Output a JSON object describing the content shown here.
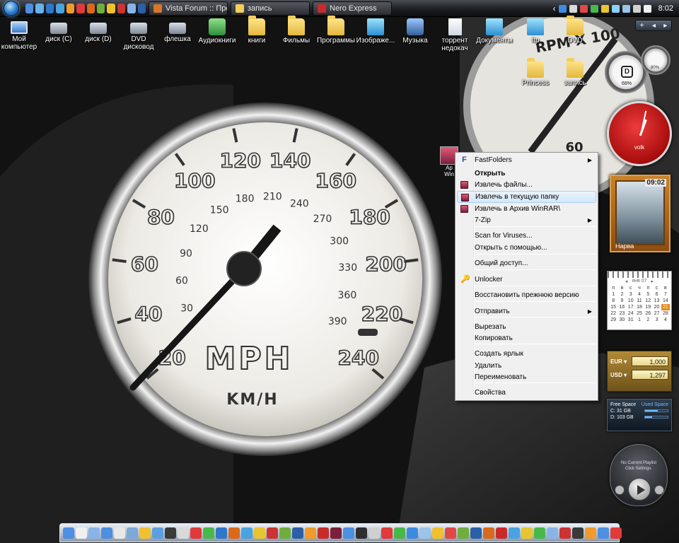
{
  "taskbar": {
    "tasks": [
      {
        "label": "Vista Forum :: Прос...",
        "color": "#d9762a"
      },
      {
        "label": "запись",
        "color": "#f2cf5d"
      },
      {
        "label": "Nero Express",
        "color": "#c92b2b"
      }
    ],
    "quick_launch_colors": [
      "#4d8fe0",
      "#69b3e8",
      "#2f77c8",
      "#4aa3df",
      "#f09b2c",
      "#e03a3a",
      "#d96a1b",
      "#6fae3c",
      "#f0c02f",
      "#cc3333",
      "#8ab4e8",
      "#2b5fa8"
    ],
    "tray_icon_colors": [
      "#3d8be0",
      "#d9d9d9",
      "#e04848",
      "#48b84a",
      "#e8c530",
      "#8bd0ff",
      "#9ac4ea",
      "#d0d0d0",
      "#f0f0f0"
    ],
    "clock": "8:02",
    "chevron": "‹"
  },
  "desktop_icons": [
    {
      "label": "Мой компьютер",
      "icon": "pc"
    },
    {
      "label": "диск (C)",
      "icon": "drive"
    },
    {
      "label": "диск (D)",
      "icon": "drive"
    },
    {
      "label": "DVD дисковод",
      "icon": "drive"
    },
    {
      "label": "флешка",
      "icon": "drive"
    },
    {
      "label": "Аудиокниги",
      "icon": "green"
    },
    {
      "label": "книги",
      "icon": "folder"
    },
    {
      "label": "Фильмы",
      "icon": "folder"
    },
    {
      "label": "Программы",
      "icon": "folder"
    },
    {
      "label": "Изображе...",
      "icon": "img"
    },
    {
      "label": "Музыка",
      "icon": "music"
    },
    {
      "label": "торрент недокач",
      "icon": "doc"
    },
    {
      "label": "Документы",
      "icon": "img"
    },
    {
      "label": "ftp",
      "icon": "img"
    },
    {
      "label": "DVD",
      "icon": "folder"
    },
    {
      "label": "Princess",
      "icon": "folder"
    },
    {
      "label": "запись",
      "icon": "folder"
    }
  ],
  "dragged_file": {
    "label_1": "Ар",
    "label_2": "Win"
  },
  "context_menu": {
    "items": [
      {
        "label": "FastFolders",
        "icon": "F",
        "submenu": true
      },
      {
        "label": "Открыть",
        "bold": true
      },
      {
        "label": "Извлечь файлы...",
        "icon": "rar"
      },
      {
        "label": "Извлечь в текущую папку",
        "icon": "rar",
        "highlighted": true
      },
      {
        "label": "Извлечь в Архив WinRAR\\",
        "icon": "rar"
      },
      {
        "label": "7-Zip",
        "submenu": true
      },
      {
        "label": "Scan for Viruses..."
      },
      {
        "label": "Открыть с помощью..."
      },
      {
        "label": "Общий доступ..."
      },
      {
        "label": "Unlocker",
        "icon": "key"
      },
      {
        "label": "Восстановить прежнюю версию"
      },
      {
        "label": "Отправить",
        "submenu": true
      },
      {
        "label": "Вырезать"
      },
      {
        "label": "Копировать"
      },
      {
        "label": "Создать ярлык"
      },
      {
        "label": "Удалить"
      },
      {
        "label": "Переименовать"
      },
      {
        "label": "Свойства"
      }
    ],
    "submenu_arrow": "▶"
  },
  "gadgets": {
    "sidebar_controls": [
      "+",
      "◂",
      "▸"
    ],
    "drive_meter": {
      "letter": "D",
      "percent": "68%"
    },
    "drive_meter_2": {
      "percent": "80%"
    },
    "clock": {
      "brand": "volk"
    },
    "weather": {
      "time": "09:02",
      "city": "Нарва"
    },
    "calendar": {
      "month": "янв 07",
      "weekdays": [
        "п",
        "в",
        "с",
        "ч",
        "п",
        "с",
        "в"
      ],
      "days": [
        "1",
        "2",
        "3",
        "4",
        "5",
        "6",
        "7",
        "8",
        "9",
        "10",
        "11",
        "12",
        "13",
        "14",
        "15",
        "16",
        "17",
        "18",
        "19",
        "20",
        "21",
        "22",
        "23",
        "24",
        "25",
        "26",
        "27",
        "28",
        "29",
        "30",
        "31",
        "1",
        "2",
        "3",
        "4"
      ],
      "today": "21",
      "nav_prev": "◂",
      "nav_next": "▸"
    },
    "currency": [
      {
        "code": "EUR ▾",
        "value": "1,000"
      },
      {
        "code": "USD ▾",
        "value": "1,297"
      }
    ],
    "disk_space": {
      "free_header": "Free Space",
      "used_header": "Used Space",
      "drives": [
        {
          "label": "C: 31 GB",
          "used_fraction": 0.55
        },
        {
          "label": "D: 103 GB",
          "used_fraction": 0.3
        }
      ]
    },
    "media_player": {
      "line1": "No Current Playlist",
      "line2": "Click Settings."
    }
  },
  "wallpaper": {
    "speed_labels": [
      "20",
      "40",
      "60",
      "80",
      "100",
      "120",
      "140",
      "160",
      "180",
      "200",
      "220",
      "240"
    ],
    "kmh_labels": [
      "30",
      "60",
      "90",
      "120",
      "150",
      "180",
      "210",
      "240",
      "270",
      "300",
      "330",
      "360",
      "390"
    ],
    "brand": "MPH",
    "sub": "KM/H",
    "rpm_label": "RPM X 100",
    "rpm_value": "60"
  },
  "dock": {
    "icon_colors": [
      "#4d8fe0",
      "#f0f0f0",
      "#8ab4e8",
      "#4d8fe0",
      "#e8e8e8",
      "#7ea8d8",
      "#f0c02f",
      "#5aa0e0",
      "#3a3a3a",
      "#d9d9d9",
      "#e03a3a",
      "#48b84a",
      "#2f77c8",
      "#d96a1b",
      "#4aa3df",
      "#e8c530",
      "#cc3333",
      "#6fae3c",
      "#2b5fa8",
      "#f09b2c",
      "#c92b2b",
      "#7b1f3b",
      "#4d8fe0",
      "#2f2f2f",
      "#d0d0d0",
      "#e03a3a",
      "#48b84a",
      "#3d8be0",
      "#9ac4ea",
      "#f0c02f",
      "#e04848",
      "#6fae3c",
      "#2b5fa8",
      "#d96a1b",
      "#c92b2b",
      "#4aa3df",
      "#e8c530",
      "#48b84a",
      "#8ab4e8",
      "#cc3333",
      "#3a3a3a",
      "#f09b2c",
      "#4d8fe0",
      "#e03a3a"
    ]
  }
}
